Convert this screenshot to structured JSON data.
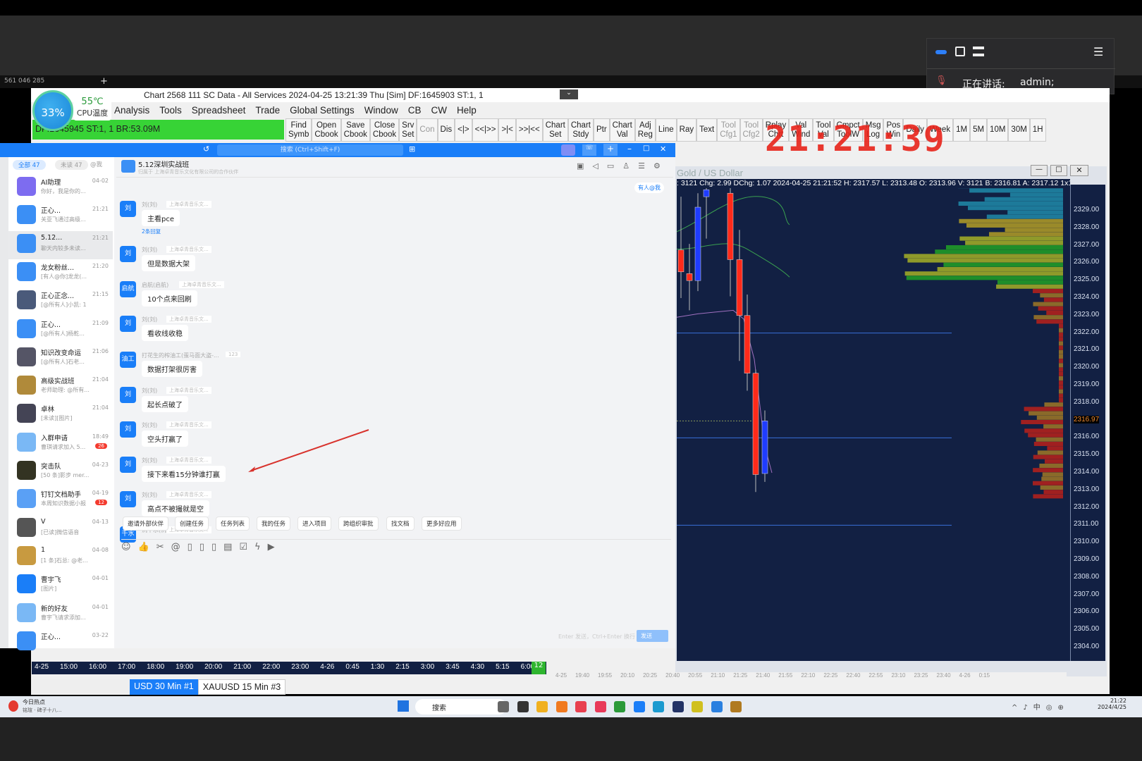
{
  "top_strip": {
    "id": "561 046 285"
  },
  "meeting": {
    "speaking_label": "正在讲话:",
    "speaker": "admin;"
  },
  "sierra": {
    "title": "Chart 2568 111 SC Data - All Services 2024-04-25  13:21:39 Thu [Sim]  DF:1645903  ST:1, 1",
    "menu": [
      "Analysis",
      "Tools",
      "Spreadsheet",
      "Trade",
      "Global Settings",
      "Window",
      "CB",
      "CW",
      "Help"
    ],
    "status": "DF:1645945  ST:1, 1  BR:53.09M",
    "cpu_percent": "33%",
    "cpu_temp": "55℃",
    "cpu_label": "CPU温度",
    "toolbar": [
      "Find\nSymb",
      "Open\nCbook",
      "Save\nCbook",
      "Close\nCbook",
      "Srv\nSet",
      "Con",
      "Dis",
      "<|>",
      "<<|>>",
      ">|<",
      ">>|<<",
      "Chart\nSet",
      "Chart\nStdy",
      "Ptr",
      "Chart\nVal",
      "Adj\nReg",
      "Line",
      "Ray",
      "Text",
      "Tool\nCfg1",
      "Tool\nCfg2",
      "Rplay\nChrt",
      "Val\nWind",
      "Tool\nVal",
      "Cmpct\nToolW",
      "Msg\nLog",
      "Pos\nWin",
      "Daily",
      "Week",
      "1M",
      "5M",
      "10M",
      "30M",
      "1H"
    ],
    "clock": "21:21:39"
  },
  "chat": {
    "search_placeholder": "搜索 (Ctrl+Shift+F)",
    "filters": [
      "全部 47",
      "未读 47",
      "@我"
    ],
    "group_name": "5.12深圳实战班",
    "group_sub": "归属于 上海卓青音乐文化有限公司的合作伙伴",
    "mention_btn": "有人@我",
    "contacts": [
      {
        "name": "AI助理",
        "time": "04-02",
        "preview": "你好，我是你的..."
      },
      {
        "name": "正心...",
        "time": "21:21",
        "preview": "关亚飞通过高级..."
      },
      {
        "name": "5.12...",
        "time": "21:21",
        "preview": "聊天内较多未读..."
      },
      {
        "name": "龙女粉丝...",
        "time": "21:20",
        "preview": "[有人@你]龙龙(..."
      },
      {
        "name": "正心正念...",
        "time": "21:15",
        "preview": "[@所有人]小凯: 1"
      },
      {
        "name": "正心...",
        "time": "21:09",
        "preview": "[@所有人]杨乾..."
      },
      {
        "name": "知识改变命运",
        "time": "21:06",
        "preview": "[@所有人]石老..."
      },
      {
        "name": "高级实战班",
        "time": "21:04",
        "preview": "老师助理: @所有..."
      },
      {
        "name": "卓林",
        "time": "21:04",
        "preview": "[未读][图片]"
      },
      {
        "name": "入群申请",
        "time": "18:49",
        "preview": "曹琪请求加入 5...",
        "badge": "26"
      },
      {
        "name": "突击队",
        "time": "04-23",
        "preview": "[50 条]影步 mer..."
      },
      {
        "name": "钉钉文档助手",
        "time": "04-19",
        "preview": "本周知识数据小报",
        "badge": "12"
      },
      {
        "name": "V",
        "time": "04-13",
        "preview": "[已读]微信语音"
      },
      {
        "name": "1",
        "time": "04-08",
        "preview": "[1 条]石总: @老..."
      },
      {
        "name": "曹宇飞",
        "time": "04-01",
        "preview": "[图片]"
      },
      {
        "name": "新的好友",
        "time": "04-01",
        "preview": "曹宇飞请求添加..."
      },
      {
        "name": "正心...",
        "time": "03-22",
        "preview": ""
      }
    ],
    "messages": [
      {
        "avatar": "刘",
        "sender": "刘(刘)",
        "org": "上海卓青音乐文...",
        "text": "主看pce",
        "replies": "2条回复"
      },
      {
        "avatar": "刘",
        "sender": "刘(刘)",
        "org": "上海卓青音乐文...",
        "text": "但是数据大架"
      },
      {
        "avatar": "启航",
        "sender": "启航(启航)",
        "org": "上海卓青音乐文...",
        "text": "10个点来回刷"
      },
      {
        "avatar": "刘",
        "sender": "刘(刘)",
        "org": "上海卓青音乐文...",
        "text": "看收线收稳"
      },
      {
        "avatar": "油工",
        "sender": "打花生的榨油工(蛋马面大盗-...",
        "org": "123",
        "text": "数据打架很厉害"
      },
      {
        "avatar": "刘",
        "sender": "刘(刘)",
        "org": "上海卓青音乐文...",
        "text": "起长点破了"
      },
      {
        "avatar": "刘",
        "sender": "刘(刘)",
        "org": "上海卓青音乐文...",
        "text": "空头打赢了"
      },
      {
        "avatar": "刘",
        "sender": "刘(刘)",
        "org": "上海卓青音乐文...",
        "text": "接下来看15分钟谁打赢"
      },
      {
        "avatar": "刘",
        "sender": "刘(刘)",
        "org": "上海卓青音乐文...",
        "text": "高点不被撮就是空"
      },
      {
        "avatar": "千水",
        "sender": "沉千水(沉千水)",
        "org": "上海卓青音乐文...",
        "text": ""
      }
    ],
    "quick_actions": [
      "邀请外部伙伴",
      "创建任务",
      "任务列表",
      "我的任务",
      "进入项目",
      "跨组织审批",
      "找文档",
      "更多好应用"
    ],
    "send_hint": "Enter 发送，Ctrl+Enter 换行",
    "send_label": "发送"
  },
  "chart": {
    "title": "Gold / US Dollar",
    "header": ": 3121  Chg: 2.99  DChg: 1.07  2024-04-25 21:21:52 H: 2317.57 L: 2313.48 O: 2313.96 V: 3121 B: 2316.81 A: 2317.12 1x1 TR:",
    "price_ticks": [
      "2329.00",
      "2328.00",
      "2327.00",
      "2326.00",
      "2325.00",
      "2324.00",
      "2323.00",
      "2322.00",
      "2321.00",
      "2320.00",
      "2319.00",
      "2318.00",
      "2317.00",
      "2316.00",
      "2315.00",
      "2314.00",
      "2313.00",
      "2312.00",
      "2311.00",
      "2310.00",
      "2309.00",
      "2308.00",
      "2307.00",
      "2306.00",
      "2305.00",
      "2304.00"
    ],
    "last_price": "2316.97",
    "time_ticks": [
      "4-25",
      "19:40",
      "19:55",
      "20:10",
      "20:25",
      "20:40",
      "20:55",
      "21:10",
      "21:25",
      "21:40",
      "21:55",
      "22:10",
      "22:25",
      "22:40",
      "22:55",
      "23:10",
      "23:25",
      "23:40",
      "4-26",
      "0:15"
    ],
    "candles": [
      {
        "o": 2326.75,
        "h": 2329.8,
        "l": 2324.0,
        "c": 2325.5
      },
      {
        "o": 2325.4,
        "h": 2327.1,
        "l": 2323.3,
        "c": 2325.0
      },
      {
        "o": 2325.0,
        "h": 2330.0,
        "l": 2324.4,
        "c": 2329.2
      },
      {
        "o": 2329.8,
        "h": 2330.4,
        "l": 2327.4,
        "c": 2330.2
      },
      {
        "o": 2330.0,
        "h": 2330.4,
        "l": 2324.1,
        "c": 2326.2
      },
      {
        "o": 2326.2,
        "h": 2327.9,
        "l": 2320.4,
        "c": 2323.0
      },
      {
        "o": 2323.0,
        "h": 2324.2,
        "l": 2318.7,
        "c": 2319.7
      },
      {
        "o": 2319.7,
        "h": 2319.9,
        "l": 2312.9,
        "c": 2313.9
      },
      {
        "o": 2313.96,
        "h": 2317.57,
        "l": 2313.48,
        "c": 2316.97
      }
    ],
    "levels": [
      2322.0,
      2316.0,
      2311.0
    ],
    "up_color": "#1f3cff",
    "down_color": "#ff2a1a"
  },
  "left_chart": {
    "time_ticks": [
      "4-25",
      "15:00",
      "16:00",
      "17:00",
      "18:00",
      "19:00",
      "20:00",
      "21:00",
      "22:00",
      "23:00",
      "4-26",
      "0:45",
      "1:30",
      "2:15",
      "3:00",
      "3:45",
      "4:30",
      "5:15",
      "6:00"
    ],
    "badge": "12"
  },
  "tabs": [
    "USD  30 Min  #1",
    "XAUUSD  15 Min  #3"
  ],
  "taskbar": {
    "news_title": "今日热点",
    "news_sub": "铭瑄 · 碑子十八...",
    "search": "搜索",
    "time": "21:22",
    "date": "2024/4/25"
  }
}
